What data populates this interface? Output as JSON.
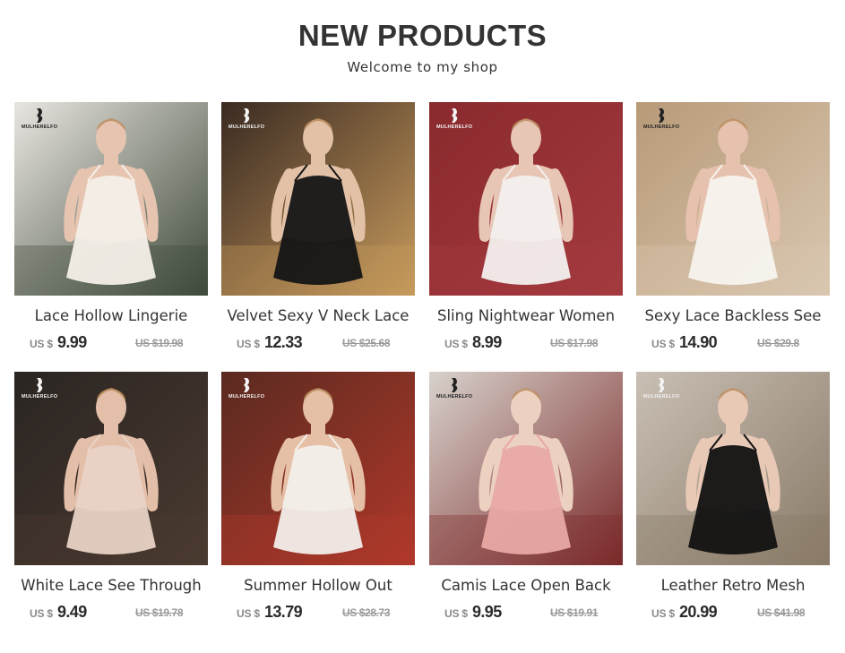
{
  "header": {
    "title": "NEW PRODUCTS",
    "subtitle": "Welcome to my shop"
  },
  "brand": {
    "logo_text": "MULHERELFO"
  },
  "products": [
    {
      "name": "Lace Hollow Lingerie",
      "currency": "US $",
      "price": "9.99",
      "old_price": "US $19.98",
      "colors": {
        "bg": "#e9e6e1",
        "accent": "#3f4a3a",
        "garment": "#f4efe8",
        "skin": "#e6c4b0",
        "logo_color": "#222222"
      }
    },
    {
      "name": "Velvet Sexy V Neck Lace",
      "currency": "US $",
      "price": "12.33",
      "old_price": "US $25.68",
      "colors": {
        "bg": "#3a2a22",
        "accent": "#c79a5c",
        "garment": "#151515",
        "skin": "#e2c1a6",
        "logo_color": "#f2f2f2"
      }
    },
    {
      "name": "Sling Nightwear Women",
      "currency": "US $",
      "price": "8.99",
      "old_price": "US $17.98",
      "colors": {
        "bg": "#8a2a2e",
        "accent": "#a33a3e",
        "garment": "#f3f0ee",
        "skin": "#e8c6b6",
        "logo_color": "#f2f2f2"
      }
    },
    {
      "name": "Sexy Lace Backless See",
      "currency": "US $",
      "price": "14.90",
      "old_price": "US $29.8",
      "colors": {
        "bg": "#b89a78",
        "accent": "#d9c7b0",
        "garment": "#f7f3ee",
        "skin": "#e6c2ae",
        "logo_color": "#222222"
      }
    },
    {
      "name": "White Lace See Through",
      "currency": "US $",
      "price": "9.49",
      "old_price": "US $19.78",
      "colors": {
        "bg": "#2a2522",
        "accent": "#4a3a30",
        "garment": "#e9d3c6",
        "skin": "#e3bea8",
        "logo_color": "#f2f2f2"
      }
    },
    {
      "name": "Summer Hollow Out",
      "currency": "US $",
      "price": "13.79",
      "old_price": "US $28.73",
      "colors": {
        "bg": "#5a2a20",
        "accent": "#b0382a",
        "garment": "#f3efea",
        "skin": "#e6c0a6",
        "logo_color": "#f2f2f2"
      }
    },
    {
      "name": "Camis Lace Open Back",
      "currency": "US $",
      "price": "9.95",
      "old_price": "US $19.91",
      "colors": {
        "bg": "#d8d2cc",
        "accent": "#7a2a2a",
        "garment": "#e8a9a4",
        "skin": "#ecd0c0",
        "logo_color": "#222222"
      }
    },
    {
      "name": "Leather Retro Mesh",
      "currency": "US $",
      "price": "20.99",
      "old_price": "US $41.98",
      "colors": {
        "bg": "#c9bfb4",
        "accent": "#8a7a68",
        "garment": "#121212",
        "skin": "#e8c9b6",
        "logo_color": "#f2f2f2"
      }
    }
  ]
}
